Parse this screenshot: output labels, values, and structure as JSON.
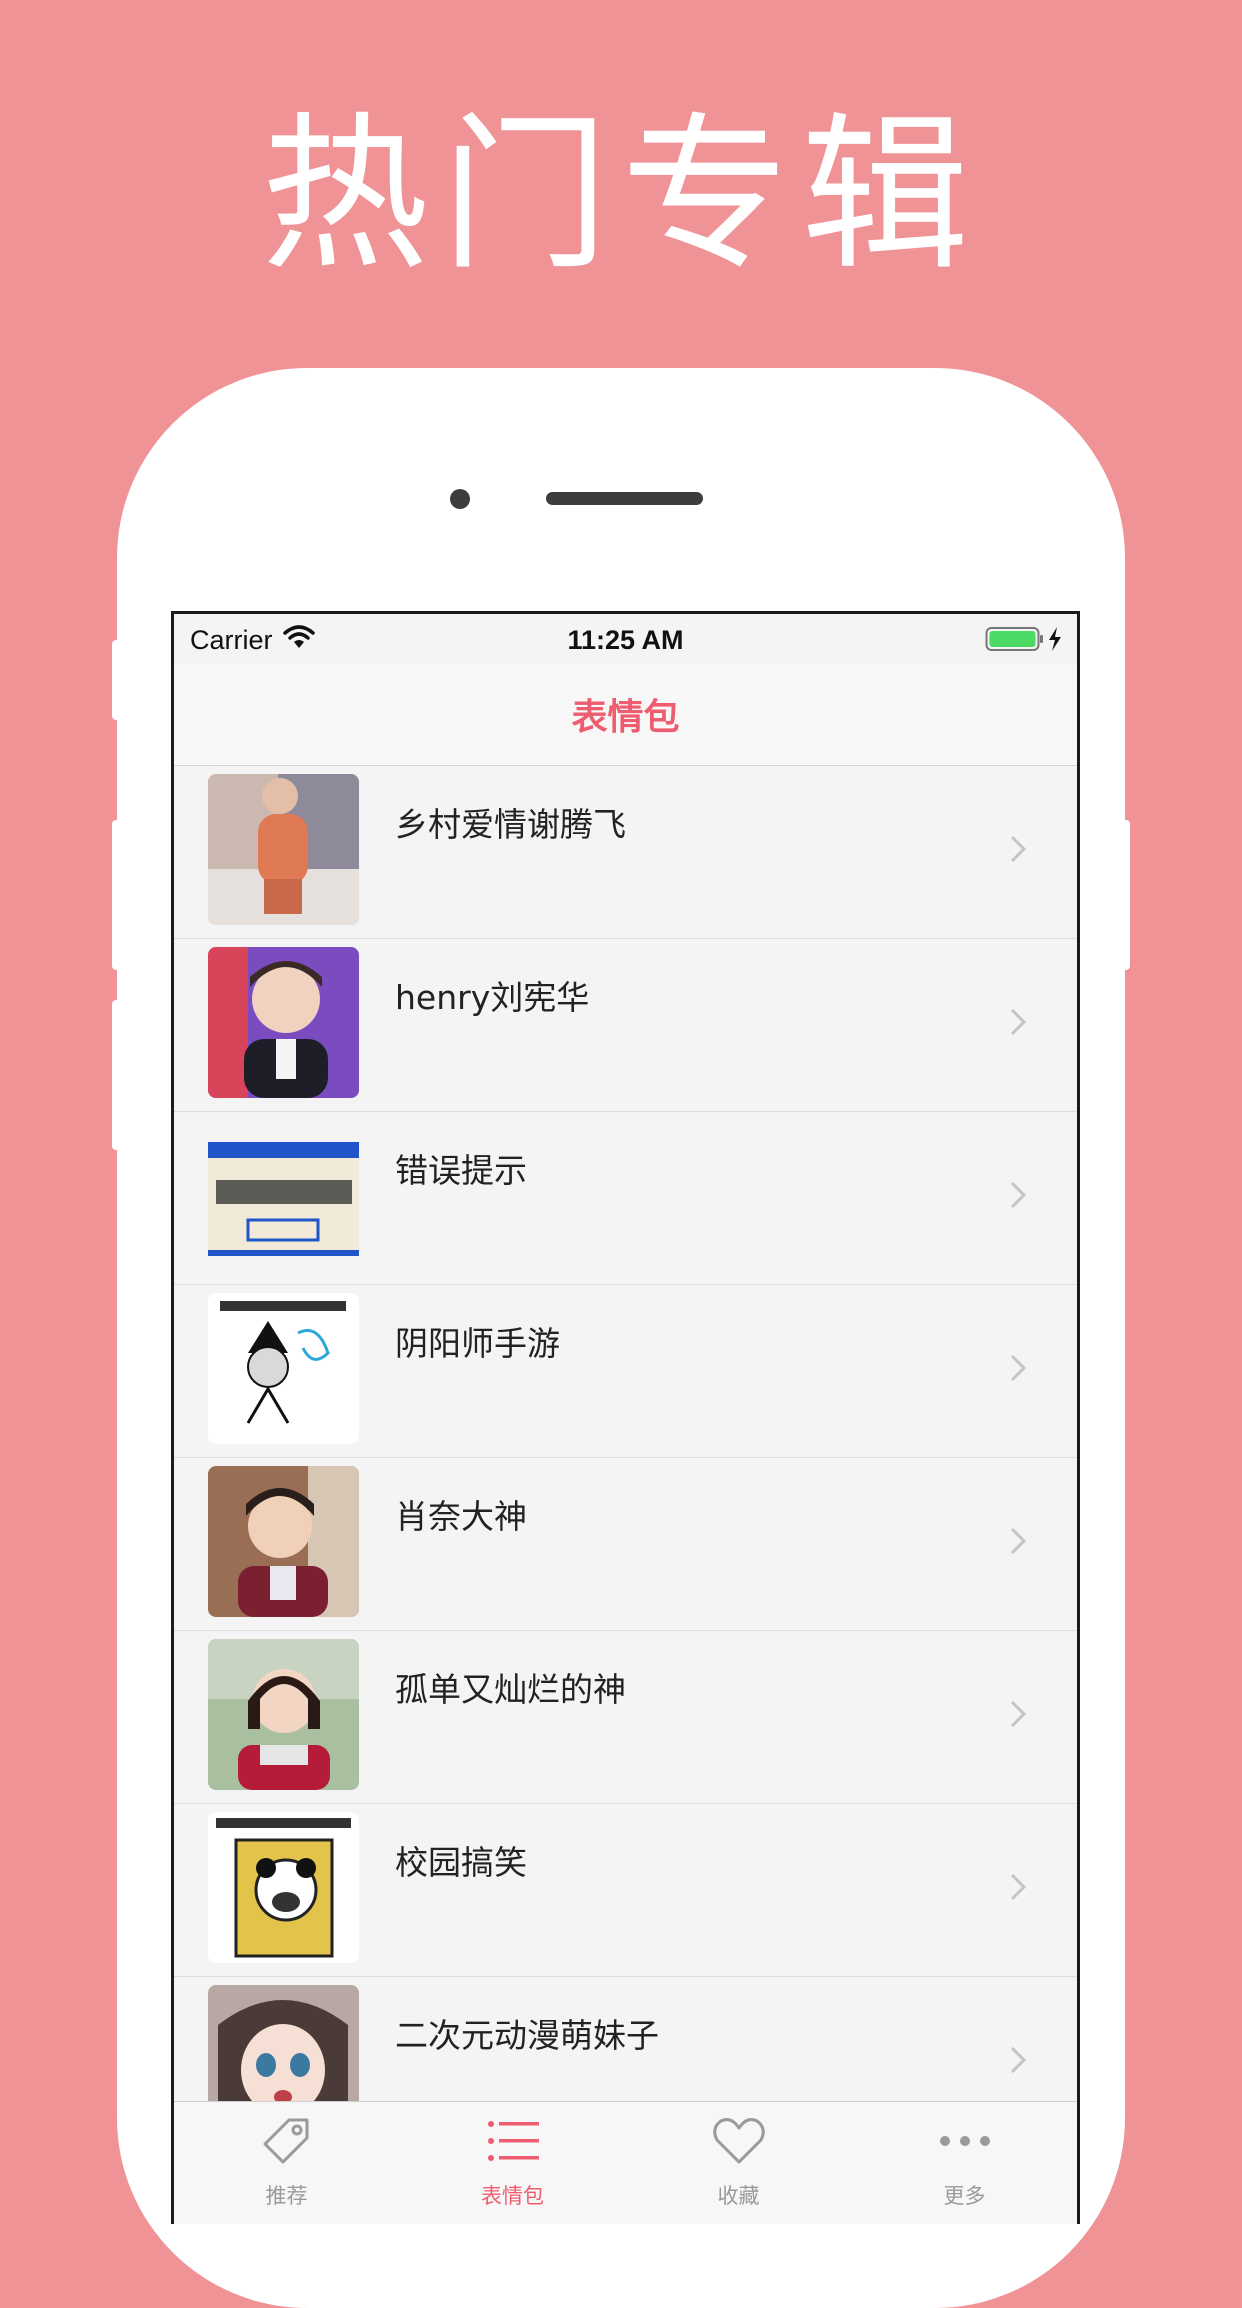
{
  "promo": {
    "title": "热门专辑"
  },
  "statusbar": {
    "carrier": "Carrier",
    "time": "11:25 AM",
    "wifi_icon": "wifi-icon",
    "battery_icon": "battery-charging-icon"
  },
  "navbar": {
    "title": "表情包"
  },
  "list": {
    "items": [
      {
        "label": "乡村爱情谢腾飞"
      },
      {
        "label": "henry刘宪华"
      },
      {
        "label": "错误提示"
      },
      {
        "label": "阴阳师手游"
      },
      {
        "label": "肖奈大神"
      },
      {
        "label": "孤单又灿烂的神"
      },
      {
        "label": "校园搞笑"
      },
      {
        "label": "二次元动漫萌妹子"
      }
    ],
    "chevron_icon": "chevron-right-icon"
  },
  "tabbar": {
    "tabs": [
      {
        "label": "推荐",
        "icon": "tag-icon",
        "active": false
      },
      {
        "label": "表情包",
        "icon": "list-icon",
        "active": true
      },
      {
        "label": "收藏",
        "icon": "heart-icon",
        "active": false
      },
      {
        "label": "更多",
        "icon": "more-icon",
        "active": false
      }
    ]
  },
  "colors": {
    "background": "#F09396",
    "accent": "#EE5D6F",
    "tab_inactive": "#9A9A9A"
  }
}
